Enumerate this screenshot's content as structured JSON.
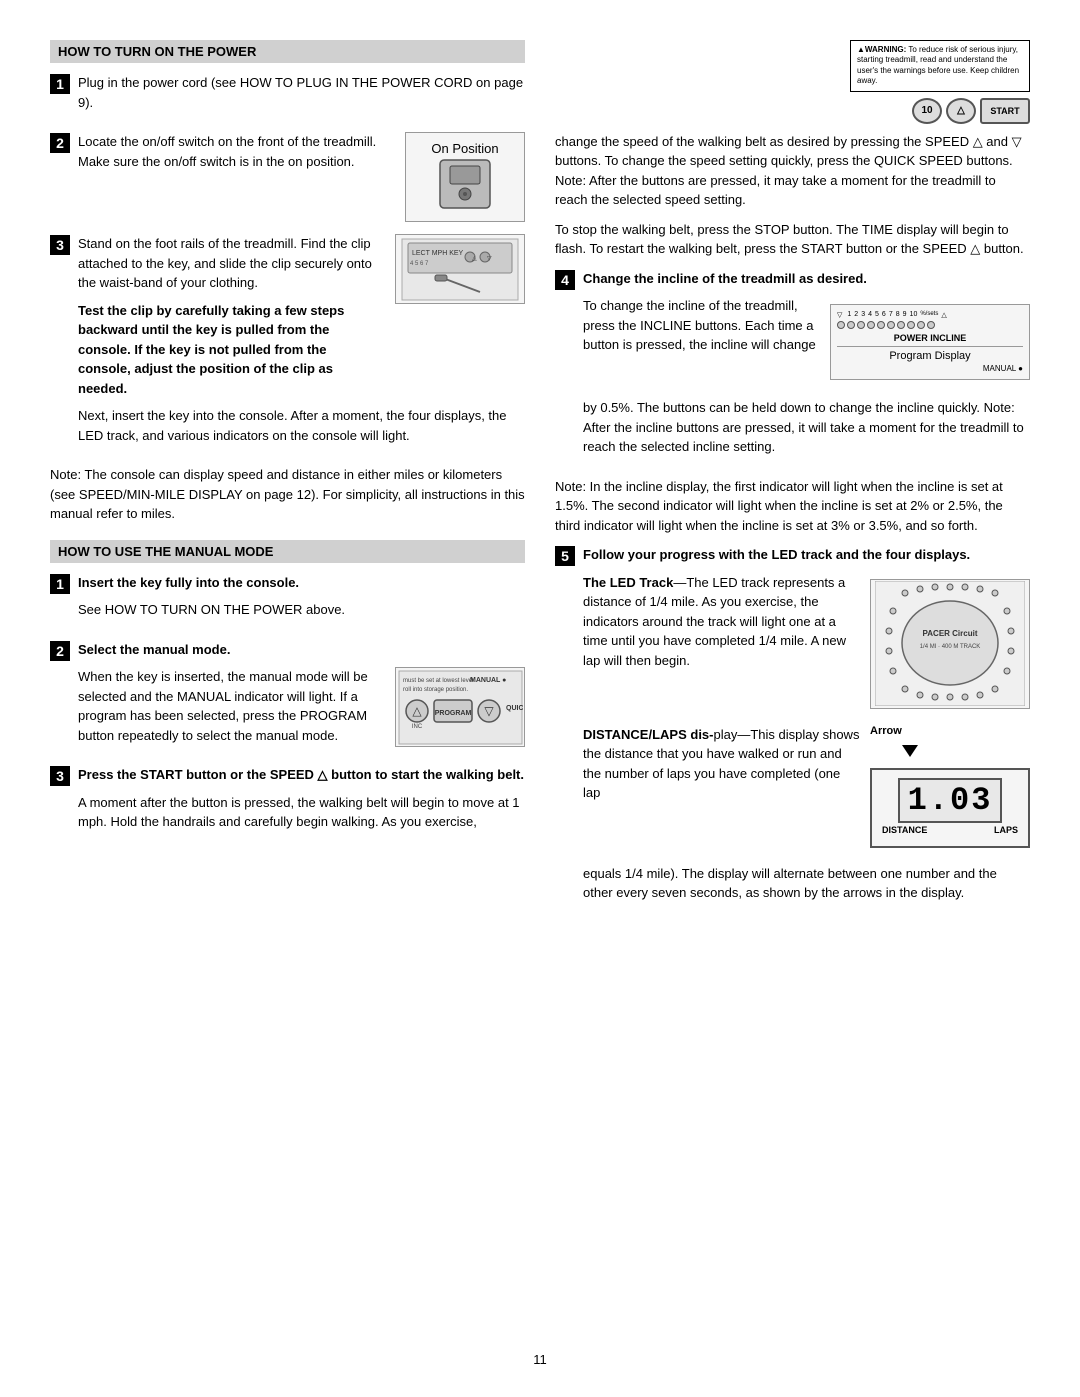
{
  "page_number": "11",
  "left_column": {
    "section1": {
      "title": "HOW TO TURN ON THE POWER",
      "steps": [
        {
          "number": "1",
          "text": "Plug in the power cord (see HOW TO PLUG IN THE POWER CORD on page 9)."
        },
        {
          "number": "2",
          "text": "Locate the on/off switch on the front of the treadmill. Make sure the on/off switch is in the on position.",
          "diagram_label": "On Position"
        },
        {
          "number": "3",
          "text_before": "Stand on the foot rails of the treadmill. Find the clip attached to the key, and slide the clip securely onto the waist-band of your clothing.",
          "bold_text": "Test the clip by carefully taking a few steps backward until the key is pulled from the console. If the key is not pulled from the console, adjust the position of the clip as needed.",
          "text_after": "Next, insert the key into the console. After a moment, the four displays, the LED track, and various indicators on the console will light."
        }
      ],
      "note": "Note: The console can display speed and distance in either miles or kilometers (see SPEED/MIN-MILE DISPLAY on page 12). For simplicity, all instructions in this manual refer to miles."
    },
    "section2": {
      "title": "HOW TO USE THE MANUAL MODE",
      "steps": [
        {
          "number": "1",
          "bold_text": "Insert the key fully into the console.",
          "text": "See HOW TO TURN ON THE POWER above."
        },
        {
          "number": "2",
          "bold_text": "Select the manual mode.",
          "text": "When the key is inserted, the manual mode will be selected and the MANUAL indicator will light. If a program has been selected, press the PROGRAM button repeatedly to select the manual mode.",
          "diagram_labels": [
            "must be set at lowest level",
            "roll into storage position",
            "MANUAL",
            "INC",
            "PROGRAM",
            "QUICK"
          ]
        },
        {
          "number": "3",
          "bold_text": "Press the START button or the SPEED △ button to start the walking belt.",
          "text": "A moment after the button is pressed, the walking belt will begin to move at 1 mph. Hold the handrails and carefully begin walking. As you exercise,"
        }
      ]
    },
    "continued_text": "change the speed of the walking belt as desired by pressing the SPEED △ and ▽ buttons. To change the speed setting quickly, press the QUICK SPEED buttons. Note: After the buttons are pressed, it may take a moment for the treadmill to reach the selected speed setting."
  },
  "right_column": {
    "text_top": "change the speed of the walking belt as desired by pressing the SPEED △ and ▽ buttons. To change the speed setting quickly, press the QUICK SPEED buttons. Note: After the buttons are pressed, it may take a moment for the treadmill to reach the selected speed setting.",
    "warning_text": "▲WARNING: To reduce risk of serious injury, starting treadmill, read and understand the user's the the warnings before use. Keep children away.",
    "speed_buttons": [
      "10",
      "△",
      "START"
    ],
    "stop_text": "To stop the walking belt, press the STOP button. The TIME display will begin to flash. To restart the walking belt, press the START button or the SPEED △ button.",
    "step4": {
      "number": "4",
      "bold_text": "Change the incline of the treadmill as desired.",
      "text": "To change the incline of the treadmill, press the INCLINE buttons. Each time a button is pressed, the incline will change by 0.5%. The buttons can be held down to change the incline quickly. Note: After the incline buttons are pressed, it will take a moment for the treadmill to reach the selected incline setting.",
      "diagram_label": "Program Display",
      "incline_numbers": [
        "1",
        "2",
        "3",
        "4",
        "5",
        "6",
        "7",
        "8",
        "9",
        "10",
        "%/sets"
      ],
      "incline_section_label": "POWER INCLINE"
    },
    "incline_note": "Note: In the incline display, the first indicator will light when the incline is set at 1.5%. The second indicator will light when the incline is set at 2% or 2.5%, the third indicator will light when the incline is set at 3% or 3.5%, and so forth.",
    "step5": {
      "number": "5",
      "bold_text": "Follow your progress with the LED track and the four displays.",
      "led_track_heading": "The LED Track",
      "led_track_text": "The LED track represents a distance of 1/4 mile. As you exercise, the indicators around the track will light one at a time until you have completed 1/4 mile. A new lap will then begin.",
      "pacer_labels": [
        "PACER Circuit",
        "1/4 MI · 400 M TRACK"
      ],
      "distance_heading": "DISTANCE/LAPS dis-",
      "distance_text": "play—This display shows the distance that you have walked or run and the number of laps you have completed (one lap equals 1/4 mile). The display will alternate between one number and the other every seven seconds, as shown by the arrows in the display.",
      "distance_value": "1.03",
      "distance_label1": "DISTANCE",
      "distance_label2": "LAPS",
      "arrow_label": "Arrow"
    }
  }
}
